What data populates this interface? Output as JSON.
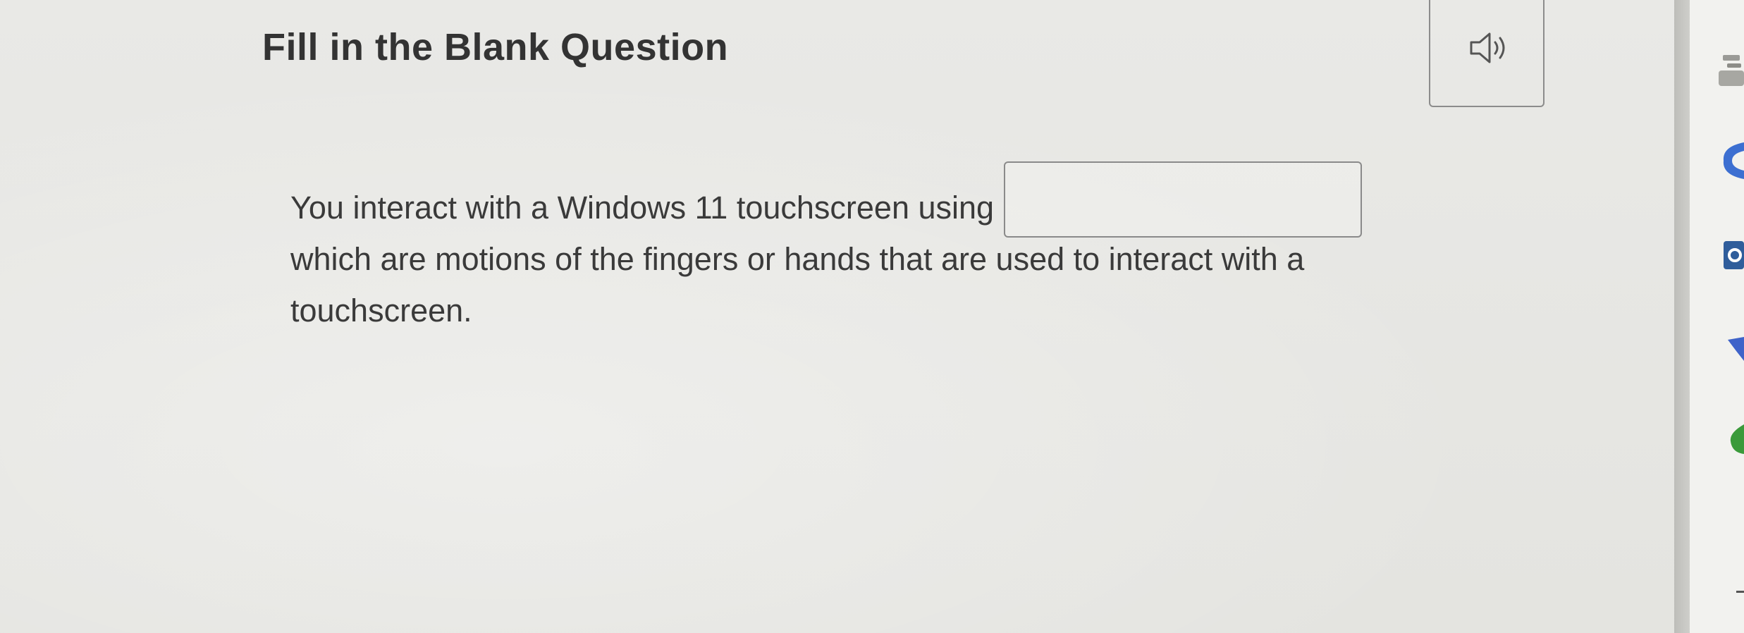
{
  "question": {
    "title": "Fill in the Blank Question",
    "text_before": "You interact with a Windows 11 touchscreen using",
    "text_line2": "which are motions of the fingers or hands that are used to interact with a",
    "text_line3": "touchscreen.",
    "blank": {
      "value": "",
      "placeholder": ""
    }
  },
  "icons": {
    "audio": "speaker-icon"
  },
  "colors": {
    "background": "#e6e6e3",
    "text": "#333333",
    "border": "#8a8a8a"
  }
}
